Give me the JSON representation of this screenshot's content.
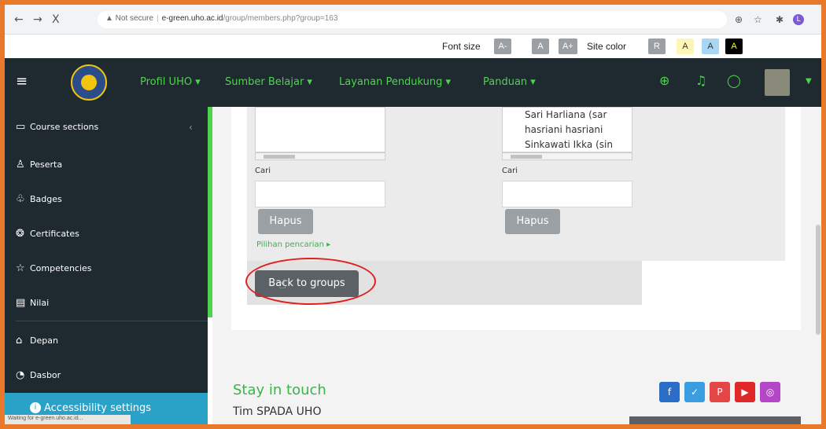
{
  "browser": {
    "back": "←",
    "forward": "→",
    "stop": "X",
    "security_label": "▲ Not secure",
    "url_host": "e-green.uho.ac.id",
    "url_path": "/group/members.php?group=163",
    "profile_initial": "L"
  },
  "a11y_bar": {
    "font_size_label": "Font size",
    "font_buttons": [
      "A-",
      "A",
      "A+"
    ],
    "site_color_label": "Site color",
    "color_buttons": [
      "R",
      "A",
      "A",
      "A"
    ]
  },
  "navbar": {
    "menu": [
      "Profil UHO ▾",
      "Sumber Belajar ▾",
      "Layanan Pendukung ▾",
      "Panduan ▾"
    ],
    "icons": [
      "globe-icon",
      "bell-icon",
      "chat-icon"
    ]
  },
  "sidebar": {
    "items": [
      {
        "label": "Course sections",
        "icon": "folder-icon"
      },
      {
        "label": "Peserta",
        "icon": "users-icon"
      },
      {
        "label": "Badges",
        "icon": "badge-icon"
      },
      {
        "label": "Certificates",
        "icon": "certificate-icon"
      },
      {
        "label": "Competencies",
        "icon": "star-icon"
      },
      {
        "label": "Nilai",
        "icon": "grade-icon"
      },
      {
        "label": "Depan",
        "icon": "home-icon"
      },
      {
        "label": "Dasbor",
        "icon": "dashboard-icon"
      }
    ],
    "accessibility_settings": "Accessibility settings",
    "status": "Waiting for e-green.uho.ac.id..."
  },
  "form": {
    "right_list": [
      "Sari Harliana (sar",
      "hasriani hasriani",
      "Sinkawati Ikka (sin"
    ],
    "search_label": "Cari",
    "remove_label": "Hapus",
    "advanced_search": "Pilihan pencarian ▸",
    "back_label": "Back to groups"
  },
  "footer": {
    "title": "Stay in touch",
    "subtitle": "Tim SPADA UHO",
    "social": [
      "facebook-icon",
      "twitter-icon",
      "pinterest-icon",
      "youtube-icon",
      "instagram-icon"
    ]
  }
}
